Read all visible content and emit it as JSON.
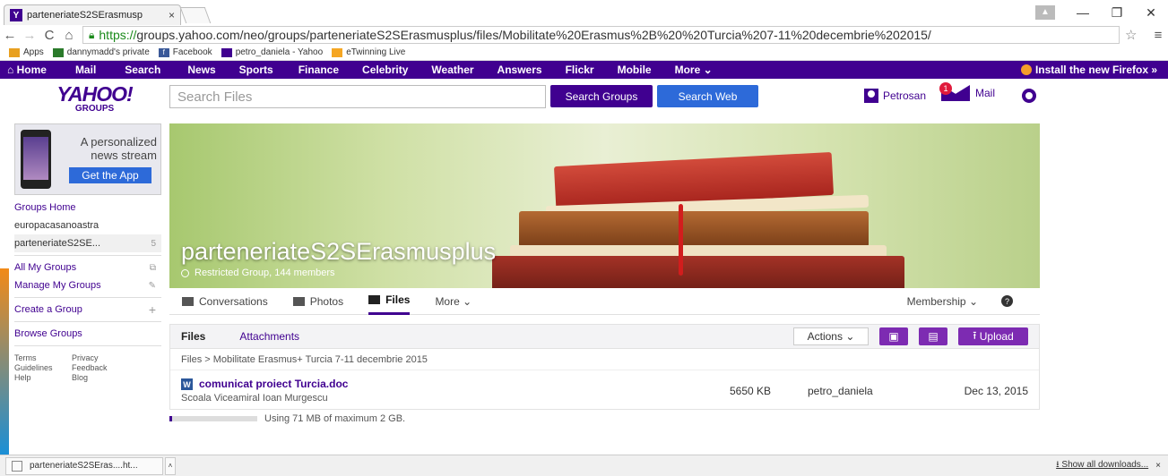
{
  "browser": {
    "tab_title": "parteneriateS2SErasmusp",
    "url_scheme": "https://",
    "url_rest": "groups.yahoo.com/neo/groups/parteneriateS2SErasmusplus/files/Mobilitate%20Erasmus%2B%20%20Turcia%207-11%20decembrie%202015/",
    "bookmarks": [
      {
        "label": "Apps",
        "icon_color": "#e8a020"
      },
      {
        "label": "dannymadd's private",
        "icon_color": "#2a7a2a"
      },
      {
        "label": "Facebook",
        "icon_color": "#3b5998"
      },
      {
        "label": "petro_daniela - Yahoo",
        "icon_color": "#400090"
      },
      {
        "label": "eTwinning Live",
        "icon_color": "#f5a623"
      }
    ]
  },
  "yahoo_nav": {
    "items": [
      "Home",
      "Mail",
      "Search",
      "News",
      "Sports",
      "Finance",
      "Celebrity",
      "Weather",
      "Answers",
      "Flickr",
      "Mobile",
      "More"
    ],
    "firefox": "Install the new Firefox »"
  },
  "header": {
    "logo": "YAHOO!",
    "logo_sub": "GROUPS",
    "search_placeholder": "Search Files",
    "search_groups": "Search Groups",
    "search_web": "Search Web",
    "user": "Petrosan",
    "mail_badge": "1",
    "mail": "Mail"
  },
  "ad": {
    "text": "A personalized news stream",
    "button": "Get the App"
  },
  "sidebar": {
    "groups_home": "Groups Home",
    "groups": [
      {
        "name": "europacasanoastra",
        "count": ""
      },
      {
        "name": "parteneriateS2SE...",
        "count": "5"
      }
    ],
    "links": [
      "All My Groups",
      "Manage My Groups",
      "Create a Group",
      "Browse Groups"
    ],
    "footer": [
      "Terms",
      "Privacy",
      "Guidelines",
      "Feedback",
      "Help",
      "Blog"
    ]
  },
  "banner": {
    "group_name": "parteneriateS2SErasmusplus",
    "group_info": "Restricted Group, 144 members"
  },
  "tabs": {
    "items": [
      "Conversations",
      "Photos",
      "Files",
      "More"
    ],
    "membership": "Membership",
    "help": "?"
  },
  "files": {
    "tab_files": "Files",
    "tab_attachments": "Attachments",
    "actions": "Actions",
    "upload": "Upload",
    "breadcrumb": "Files  >  Mobilitate Erasmus+ Turcia 7-11 decembrie 2015",
    "rows": [
      {
        "icon": "W",
        "name": "comunicat proiect Turcia.doc",
        "description": "Scoala Viceamiral Ioan Murgescu",
        "size": "5650 KB",
        "owner": "petro_daniela",
        "date": "Dec 13, 2015"
      }
    ],
    "usage_text": "Using 71 MB of maximum 2 GB.",
    "usage_fraction": 0.035
  },
  "downloads": {
    "item": "parteneriateS2SEras....ht...",
    "show_all": "Show all downloads...",
    "close": "×"
  }
}
